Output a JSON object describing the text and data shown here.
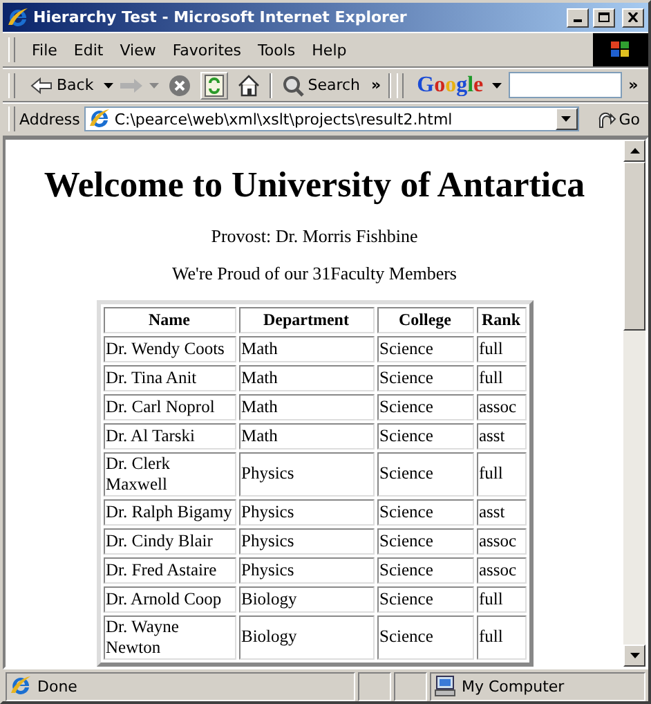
{
  "window": {
    "title": "Hierarchy Test - Microsoft Internet Explorer"
  },
  "menu": [
    {
      "label": "File"
    },
    {
      "label": "Edit"
    },
    {
      "label": "View"
    },
    {
      "label": "Favorites"
    },
    {
      "label": "Tools"
    },
    {
      "label": "Help"
    }
  ],
  "toolbar": {
    "back": "Back",
    "search": "Search",
    "chevron": "»",
    "google": "Google",
    "google_chevron": "»"
  },
  "address": {
    "label": "Address",
    "value": "C:\\pearce\\web\\xml\\xslt\\projects\\result2.html",
    "go": "Go"
  },
  "page": {
    "heading": "Welcome to University of Antartica",
    "provost": "Provost: Dr. Morris Fishbine",
    "intro": "We're Proud of our 31Faculty Members",
    "table": {
      "columns": [
        "Name",
        "Department",
        "College",
        "Rank"
      ],
      "rows": [
        [
          "Dr. Wendy Coots",
          "Math",
          "Science",
          "full"
        ],
        [
          "Dr. Tina Anit",
          "Math",
          "Science",
          "full"
        ],
        [
          "Dr. Carl Noprol",
          "Math",
          "Science",
          "assoc"
        ],
        [
          "Dr. Al Tarski",
          "Math",
          "Science",
          "asst"
        ],
        [
          "Dr. Clerk Maxwell",
          "Physics",
          "Science",
          "full"
        ],
        [
          "Dr. Ralph Bigamy",
          "Physics",
          "Science",
          "asst"
        ],
        [
          "Dr. Cindy Blair",
          "Physics",
          "Science",
          "assoc"
        ],
        [
          "Dr. Fred Astaire",
          "Physics",
          "Science",
          "assoc"
        ],
        [
          "Dr. Arnold Coop",
          "Biology",
          "Science",
          "full"
        ],
        [
          "Dr. Wayne Newton",
          "Biology",
          "Science",
          "full"
        ]
      ]
    }
  },
  "status_bar": {
    "text": "Done",
    "zone": "My Computer"
  }
}
